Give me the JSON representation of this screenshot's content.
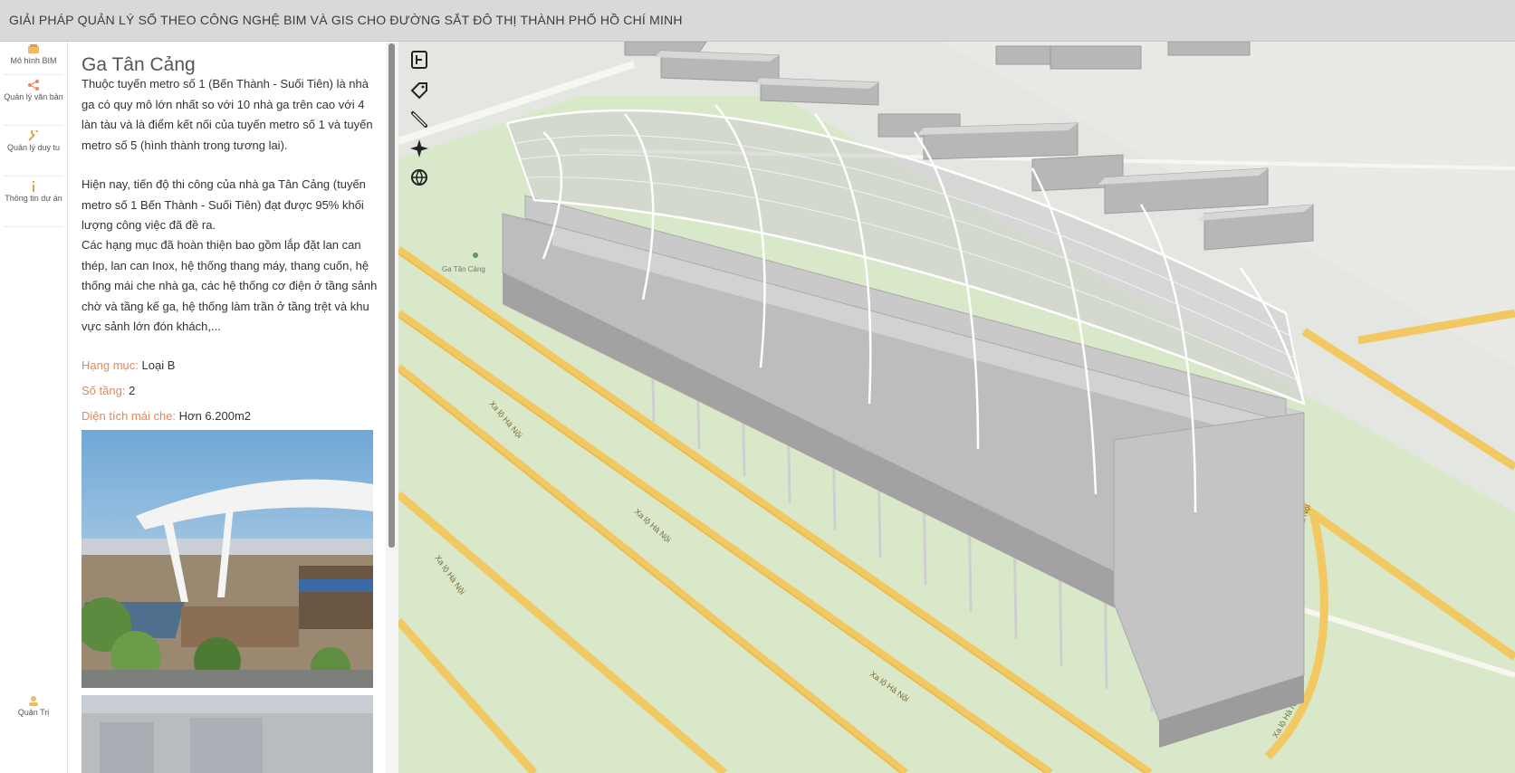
{
  "app": {
    "title": "GIẢI PHÁP QUẢN LÝ SỐ THEO CÔNG NGHỆ BIM VÀ GIS CHO ĐƯỜNG SẮT ĐÔ THỊ THÀNH PHỐ HỒ CHÍ MINH"
  },
  "nav": {
    "items": [
      {
        "label": "Mô hình BIM",
        "icon": "building-icon"
      },
      {
        "label": "Quản lý văn bản",
        "icon": "share-nodes-icon"
      },
      {
        "label": "Quản lý duy tu",
        "icon": "wrench-icon"
      },
      {
        "label": "Thông tin dự án",
        "icon": "info-icon"
      }
    ],
    "bottom": {
      "label": "Quản Trị",
      "icon": "user-icon"
    }
  },
  "panel": {
    "title": "Ga Tân Cảng",
    "paragraphs": [
      "Thuộc tuyến metro số 1 (Bến Thành - Suối Tiên) là nhà ga có quy mô lớn nhất so với 10 nhà ga trên cao với 4 làn tàu và là điểm kết nối của tuyến metro số 1 và tuyến metro số 5 (hình thành trong tương lai).",
      "Hiện nay, tiến độ thi công của nhà ga Tân Cảng (tuyến metro số 1 Bến Thành - Suối Tiên) đạt được 95% khối lượng công việc đã đề ra.",
      "Các hạng mục đã hoàn thiện bao gồm lắp đặt lan can thép, lan can Inox, hệ thống thang máy, thang cuốn, hệ thống mái che nhà ga, các hệ thống cơ điện ở tầng sảnh chờ và tầng kế ga, hệ thống làm trần ở tầng trệt và khu vực sảnh lớn đón khách,..."
    ],
    "attributes": [
      {
        "key": "Hạng mục:",
        "value": "Loại B"
      },
      {
        "key": "Số tầng:",
        "value": "2"
      },
      {
        "key": "Diện tích mái che:",
        "value": "Hơn 6.200m2"
      }
    ]
  },
  "map": {
    "station_label": "Ga Tân Cảng",
    "road_labels": [
      "Xa lộ Hà Nội",
      "Xa lộ Hà Nội",
      "Xa lộ Hà Nội",
      "Xa lộ Hà Nội",
      "Xa lộ Hà Nội",
      "Xa lộ Hà Nội"
    ],
    "tools": [
      "layers-icon",
      "tag-icon",
      "measure-icon",
      "navigation-icon",
      "globe-icon"
    ]
  },
  "colors": {
    "accent": "#e8865a",
    "road": "#f4c95d",
    "map_bg": "#e3e6df",
    "park": "#d8e8c6",
    "building": "#b9b9b9"
  }
}
